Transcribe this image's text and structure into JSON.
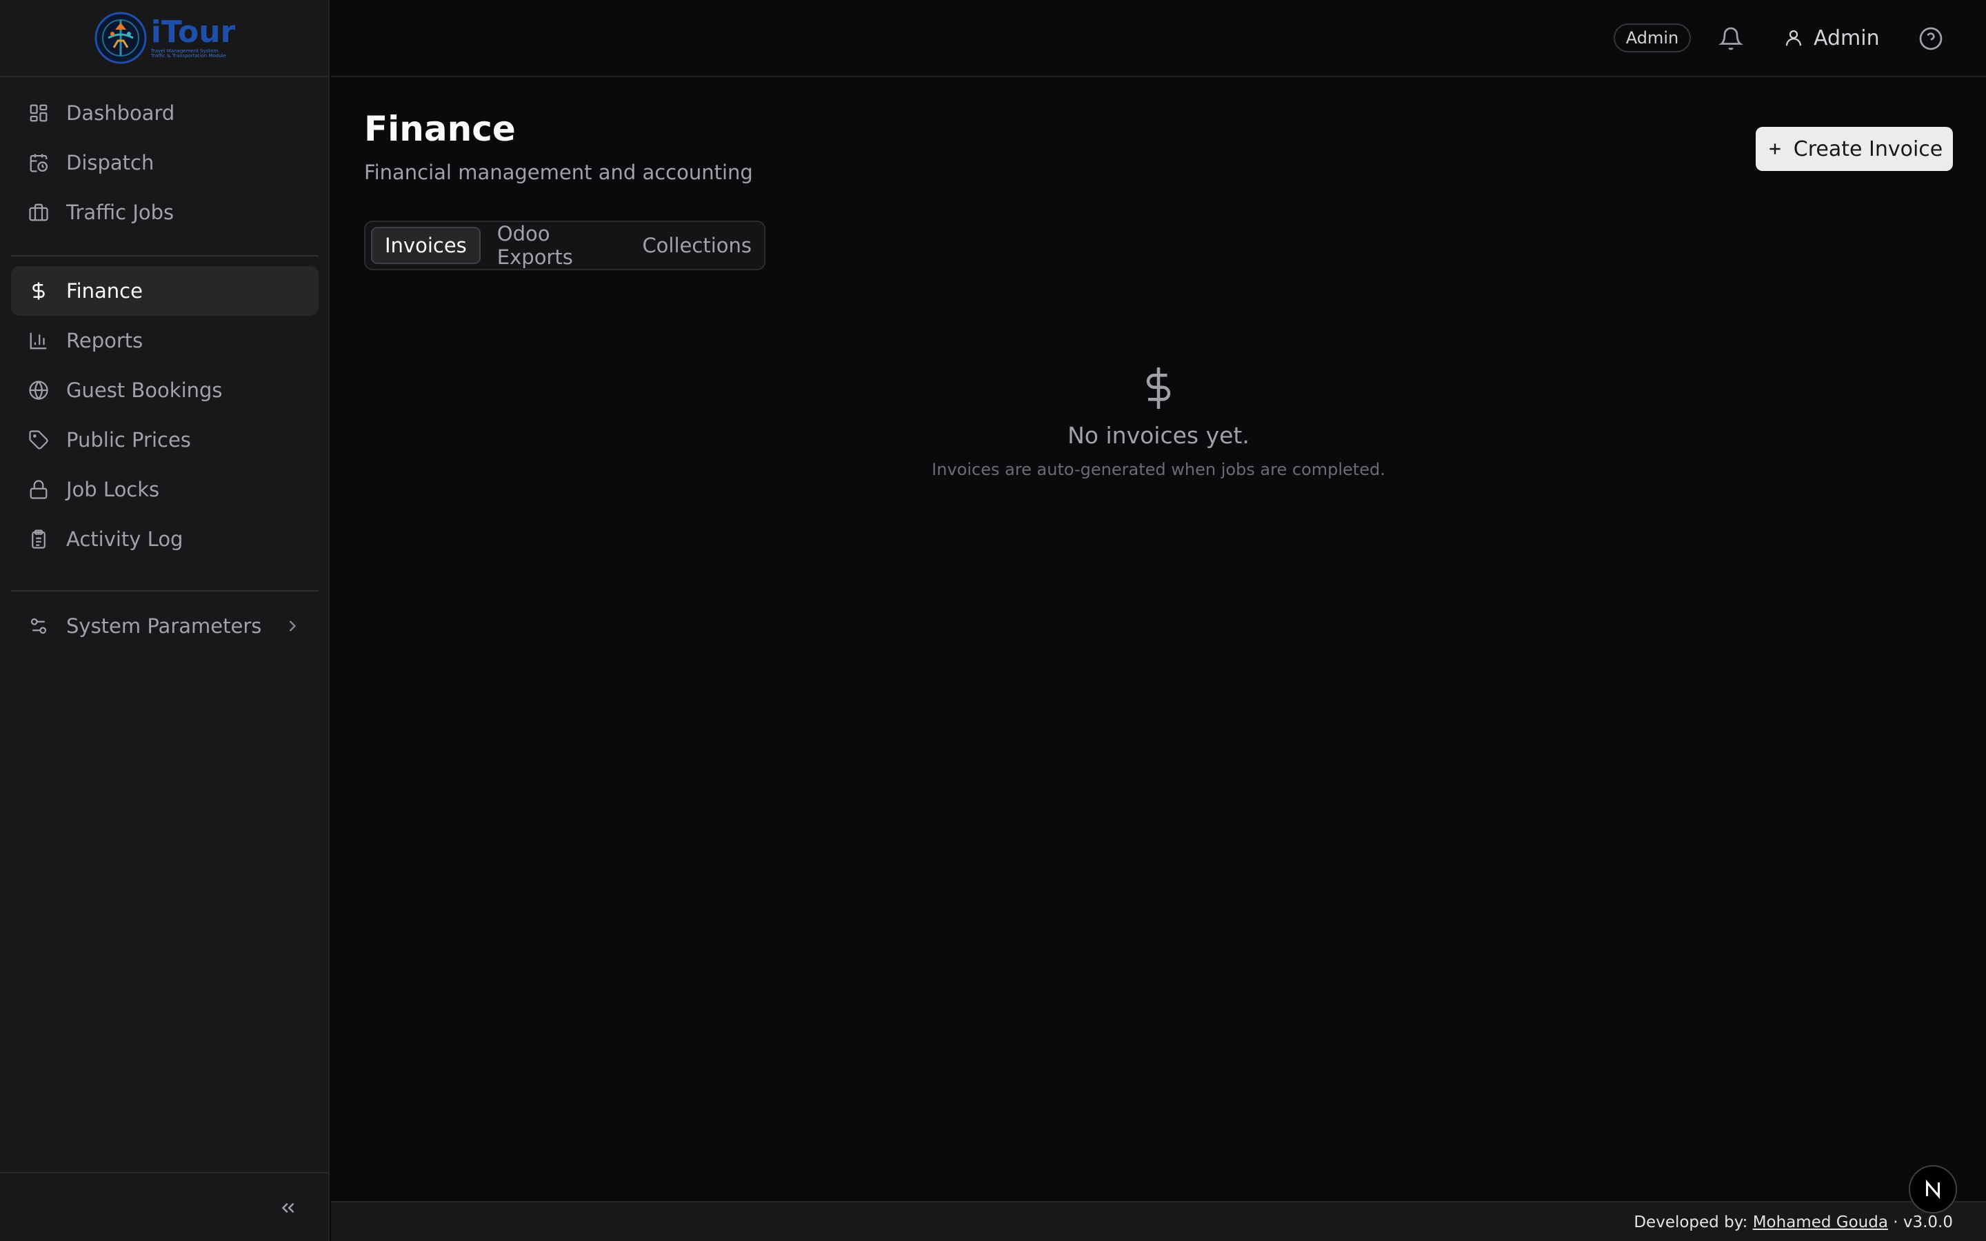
{
  "app": {
    "logo_word": "iTour",
    "logo_subtitle_1": "Travel Management System",
    "logo_subtitle_2": "Traffic & Transportation Module"
  },
  "sidebar": {
    "items": [
      {
        "label": "Dashboard",
        "icon": "dashboard-icon"
      },
      {
        "label": "Dispatch",
        "icon": "calendar-clock-icon"
      },
      {
        "label": "Traffic Jobs",
        "icon": "briefcase-icon"
      },
      {
        "label": "Finance",
        "icon": "dollar-icon",
        "active": true
      },
      {
        "label": "Reports",
        "icon": "bar-chart-icon"
      },
      {
        "label": "Guest Bookings",
        "icon": "globe-icon"
      },
      {
        "label": "Public Prices",
        "icon": "tag-icon"
      },
      {
        "label": "Job Locks",
        "icon": "lock-icon"
      },
      {
        "label": "Activity Log",
        "icon": "clipboard-icon"
      },
      {
        "label": "System Parameters",
        "icon": "sliders-icon"
      }
    ]
  },
  "topbar": {
    "role_badge": "Admin",
    "user_name": "Admin"
  },
  "page": {
    "title": "Finance",
    "subtitle": "Financial management and accounting",
    "create_button": "Create Invoice"
  },
  "tabs": [
    {
      "label": "Invoices",
      "active": true
    },
    {
      "label": "Odoo Exports"
    },
    {
      "label": "Collections"
    }
  ],
  "empty_state": {
    "title": "No invoices yet.",
    "subtitle": "Invoices are auto-generated when jobs are completed."
  },
  "footer": {
    "prefix": "Developed by:",
    "author": "Mohamed Gouda",
    "version": "· v3.0.0"
  },
  "colors": {
    "background": "#0a0a0c",
    "sidebar": "#18181b",
    "active_item": "#27272a",
    "brand_blue": "#1f4fa8",
    "button_bg": "#ececee"
  }
}
